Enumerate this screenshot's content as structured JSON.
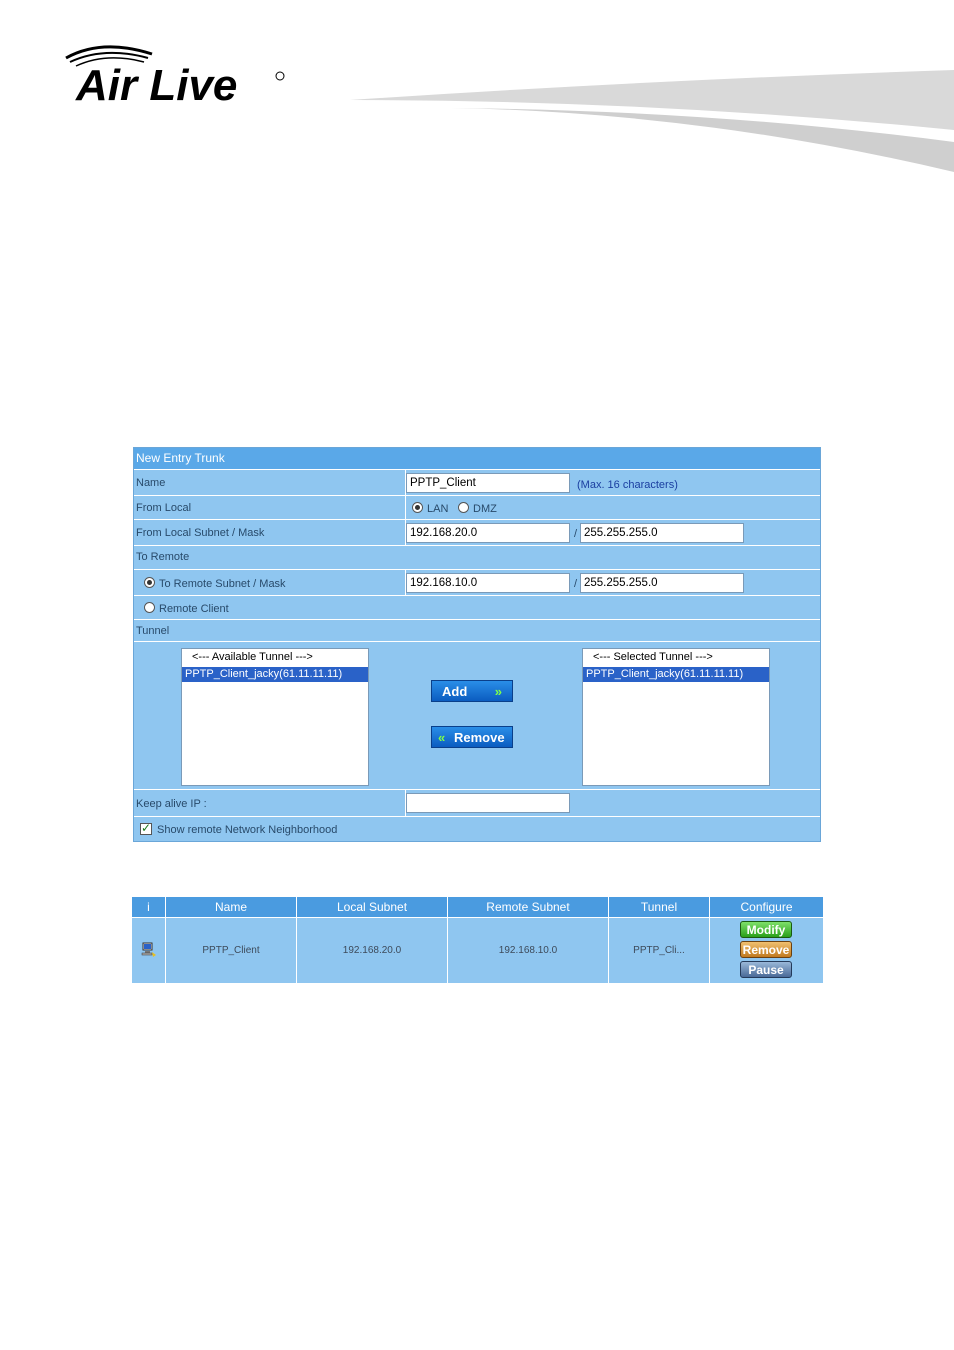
{
  "brand": {
    "logo_text": "Air Live"
  },
  "form": {
    "title": "New Entry Trunk",
    "name": {
      "label": "Name",
      "value": "PPTP_Client",
      "hint": "(Max. 16 characters)"
    },
    "from_local": {
      "label": "From Local",
      "options": [
        "LAN",
        "DMZ"
      ],
      "selected": "LAN"
    },
    "local_subnet": {
      "label": "From Local Subnet / Mask",
      "ip": "192.168.20.0",
      "separator": "/",
      "mask": "255.255.255.0"
    },
    "to_remote": {
      "label": "To Remote"
    },
    "remote_subnet": {
      "label": "To Remote Subnet / Mask",
      "ip": "192.168.10.0",
      "separator": "/",
      "mask": "255.255.255.0",
      "selected": true
    },
    "remote_client": {
      "label": "Remote Client",
      "selected": false
    },
    "tunnel": {
      "label": "Tunnel",
      "available_header": "<--- Available Tunnel --->",
      "available_items": [
        "PPTP_Client_jacky(61.11.11.11)"
      ],
      "selected_header": "<--- Selected Tunnel --->",
      "selected_items": [
        "PPTP_Client_jacky(61.11.11.11)"
      ],
      "add_label": "Add",
      "remove_label": "Remove"
    },
    "keep_alive": {
      "label": "Keep alive IP :",
      "value": ""
    },
    "show_neighborhood": {
      "label": "Show remote Network Neighborhood",
      "checked": true
    }
  },
  "table": {
    "headers": [
      "i",
      "Name",
      "Local Subnet",
      "Remote Subnet",
      "Tunnel",
      "Configure"
    ],
    "rows": [
      {
        "name": "PPTP_Client",
        "local_subnet": "192.168.20.0",
        "remote_subnet": "192.168.10.0",
        "tunnel": "PPTP_Cli..."
      }
    ],
    "actions": {
      "modify": "Modify",
      "remove": "Remove",
      "pause": "Pause"
    }
  },
  "colors": {
    "panel": "#8fc6f0",
    "header": "#4a9be0",
    "title_bar": "#5aa8e8",
    "selection": "#2a62c8"
  }
}
